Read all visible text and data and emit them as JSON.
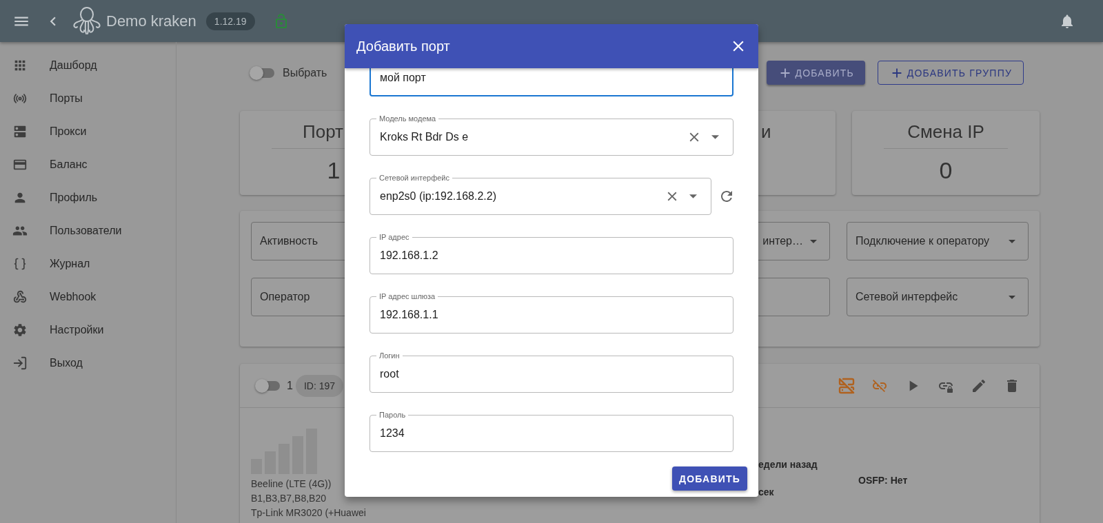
{
  "app_bar": {
    "title": "Demo kraken",
    "version": "1.12.19"
  },
  "sidebar": {
    "items": [
      {
        "label": "Дашборд"
      },
      {
        "label": "Порты"
      },
      {
        "label": "Прокси"
      },
      {
        "label": "Баланс"
      },
      {
        "label": "Профиль"
      },
      {
        "label": "Пользователи"
      },
      {
        "label": "Журнал"
      },
      {
        "label": "Webhook"
      },
      {
        "label": "Настройки"
      },
      {
        "label": "Выход"
      }
    ]
  },
  "toolbar": {
    "select_toggle": {
      "label": "Выбрать",
      "on": false
    },
    "buttons": [
      {
        "label": "ДОБАВИТЬ",
        "kind": "contained"
      },
      {
        "label": "ДОБАВИТЬ ГРУППУ",
        "kind": "outlined"
      }
    ]
  },
  "stats": [
    {
      "title": "Порт",
      "value": "1"
    },
    {
      "title": "и"
    },
    {
      "title": "Смена IP",
      "value": "0"
    }
  ],
  "filters": [
    {
      "label": "Активность"
    },
    {
      "label": "интер…"
    },
    {
      "label": "Подключение к оператору"
    },
    {
      "label": "Оператор"
    },
    {
      "label": "Сетевой интерфейс"
    }
  ],
  "port_card": {
    "toggle_on": false,
    "number": "1",
    "id_chip": "ID: 197",
    "actions": [
      {
        "kind": "server-off",
        "color": "#b0621f"
      },
      {
        "kind": "link-off",
        "color": "#b0621f"
      },
      {
        "kind": "play",
        "color": "#464646"
      },
      {
        "kind": "link-lock",
        "color": "#464646"
      },
      {
        "kind": "edit",
        "color": "#464646"
      },
      {
        "kind": "delete",
        "color": "#464646"
      }
    ],
    "info": [
      "Beeline (LTE (4G))",
      "B1,B3,B7,B8,B20",
      "Tp-Link MR3020 (+Huawei"
    ],
    "details": [
      "едели назад",
      "сек"
    ],
    "osfp": "OSFP: Нет"
  },
  "dialog": {
    "title": "Добавить порт",
    "fields": [
      {
        "kind": "text",
        "value": "мой порт",
        "focused": true,
        "refresh": false
      },
      {
        "kind": "select",
        "label": "Модель модема",
        "value": "Kroks Rt Bdr Ds e",
        "focused": false,
        "refresh": false
      },
      {
        "kind": "select",
        "label": "Сетевой интерфейс",
        "value": "enp2s0 (ip:192.168.2.2)",
        "focused": false,
        "refresh": true
      },
      {
        "kind": "text",
        "label": "IP адрес",
        "value": "192.168.1.2",
        "focused": false,
        "refresh": false
      },
      {
        "kind": "text",
        "label": "IP адрес шлюза",
        "value": "192.168.1.1",
        "focused": false,
        "refresh": false
      },
      {
        "kind": "text",
        "label": "Логин",
        "value": "root",
        "focused": false,
        "refresh": false
      },
      {
        "kind": "text",
        "label": "Пароль",
        "value": "1234",
        "focused": false,
        "refresh": false
      }
    ],
    "submit": "ДОБАВИТЬ"
  }
}
